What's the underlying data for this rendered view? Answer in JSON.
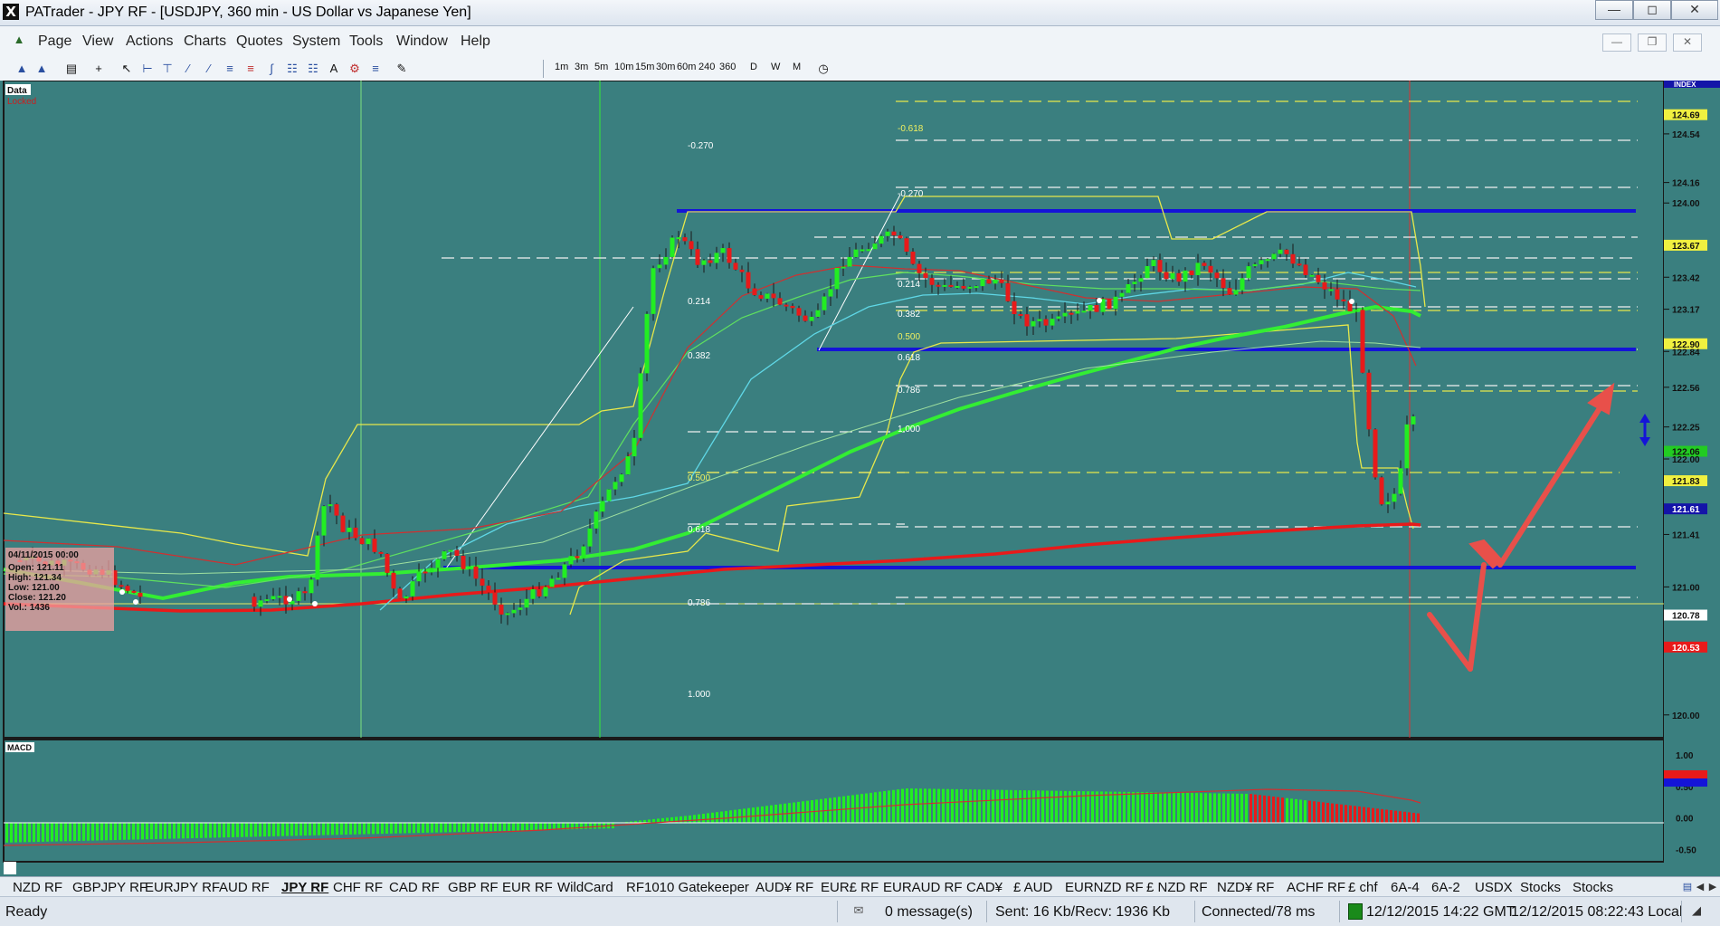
{
  "window": {
    "title": "PATrader - JPY RF - [USDJPY, 360 min - US Dollar vs Japanese Yen]",
    "app_icon": "X"
  },
  "menu": [
    "Page",
    "View",
    "Actions",
    "Charts",
    "Quotes",
    "System",
    "Tools",
    "Window",
    "Help"
  ],
  "timeframes": [
    "1m",
    "3m",
    "5m",
    "10m",
    "15m",
    "30m",
    "60m",
    "240",
    "360",
    "D",
    "W",
    "M"
  ],
  "chart": {
    "top_left_labels": [
      "Data",
      "Locked"
    ],
    "index_label": "INDEX",
    "macd_label": "MACD",
    "info_box": {
      "date": "04/11/2015 00:00",
      "open": "Open: 121.11",
      "high": "High: 121.34",
      "low": "Low: 121.00",
      "close": "Close: 121.20",
      "vol": "Vol.: 1436"
    },
    "price_scale": [
      "124.69",
      "124.54",
      "124.16",
      "124.00",
      "123.67",
      "123.42",
      "123.17",
      "122.90",
      "122.84",
      "122.56",
      "122.25",
      "122.06",
      "122.00",
      "121.83",
      "121.61",
      "121.41",
      "121.00",
      "120.78",
      "120.53",
      "120.00"
    ],
    "macd_scale": [
      "1.00",
      "0.50",
      "0.00",
      "-0.50"
    ],
    "fib_left": [
      "-0.270",
      "0.214",
      "0.382",
      "0.500",
      "0.618",
      "0.786",
      "1.000"
    ],
    "fib_right": [
      "-0.618",
      "-0.270",
      "0.214",
      "0.382",
      "0.500",
      "0.618",
      "0.786",
      "1.000"
    ],
    "colors": {
      "background": "#3a7f7f",
      "bull": "#22ee22",
      "bear": "#e81a1a",
      "level": "#1414d8",
      "ma_green": "#22ee22",
      "ma_red": "#e81a1a",
      "arrow": "#e8504a"
    }
  },
  "tabs": [
    "NZD RF",
    "GBPJPY RF",
    "EURJPY RF",
    "AUD RF",
    "JPY RF",
    "CHF RF",
    "CAD RF",
    "GBP RF",
    "EUR RF",
    "WildCard",
    "RF1010 Gatekeeper",
    "AUD¥ RF",
    "EUR£ RF",
    "EURAUD RF",
    "CAD¥",
    "£ AUD",
    "EURNZD RF",
    "£ NZD RF",
    "NZD¥ RF",
    "ACHF RF",
    "£ chf",
    "6A-4",
    "6A-2",
    "USDX",
    "Stocks",
    "Stocks"
  ],
  "active_tab": "JPY RF",
  "status": {
    "ready": "Ready",
    "messages": "0 message(s)",
    "traffic": "Sent: 16 Kb/Recv: 1936 Kb",
    "connection": "Connected/78 ms",
    "gmt_time": "12/12/2015 14:22 GMT",
    "local_time": "12/12/2015 08:22:43 Local"
  }
}
